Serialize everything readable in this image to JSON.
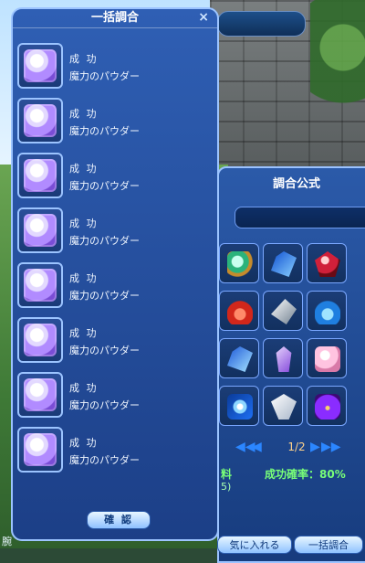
{
  "bulk_panel": {
    "title": "一括調合",
    "close_symbol": "×",
    "confirm_label": "確 認",
    "results": [
      {
        "status": "成 功",
        "item": "魔力のパウダー"
      },
      {
        "status": "成 功",
        "item": "魔力のパウダー"
      },
      {
        "status": "成 功",
        "item": "魔力のパウダー"
      },
      {
        "status": "成 功",
        "item": "魔力のパウダー"
      },
      {
        "status": "成 功",
        "item": "魔力のパウダー"
      },
      {
        "status": "成 功",
        "item": "魔力のパウダー"
      },
      {
        "status": "成 功",
        "item": "魔力のパウダー"
      },
      {
        "status": "成 功",
        "item": "魔力のパウダー"
      }
    ]
  },
  "formula_panel": {
    "title": "調合公式",
    "pager": {
      "first_symbol": "◀◀",
      "prev_symbol": "◀",
      "next_symbol": "▶",
      "last_symbol": "▶▶",
      "page_text": "1/2"
    },
    "ingredients_label": "料",
    "ingredients_sub": "5)",
    "success_rate_text": "成功確率：80%",
    "grid_items": [
      {
        "icon": "emerald-ring-icon"
      },
      {
        "icon": "blue-crystal-icon"
      },
      {
        "icon": "red-gem-icon"
      },
      {
        "icon": "red-potion-icon"
      },
      {
        "icon": "silver-shard-icon"
      },
      {
        "icon": "blue-potion-icon"
      },
      {
        "icon": "blue-crystal-icon"
      },
      {
        "icon": "purple-crystal-icon"
      },
      {
        "icon": "pink-stone-icon"
      },
      {
        "icon": "sparkle-star-icon"
      },
      {
        "icon": "clear-crystal-icon"
      },
      {
        "icon": "purple-potion-icon"
      }
    ]
  },
  "bottom_bar": {
    "left_text": "腕",
    "middle_button_label": "気に入れる",
    "right_button_label": "一括調合"
  },
  "colors": {
    "panel_bg": "#2f5fb4",
    "panel_border": "#9cc4ff",
    "success_green": "#78ff78",
    "pager_blue": "#2b86ff"
  }
}
